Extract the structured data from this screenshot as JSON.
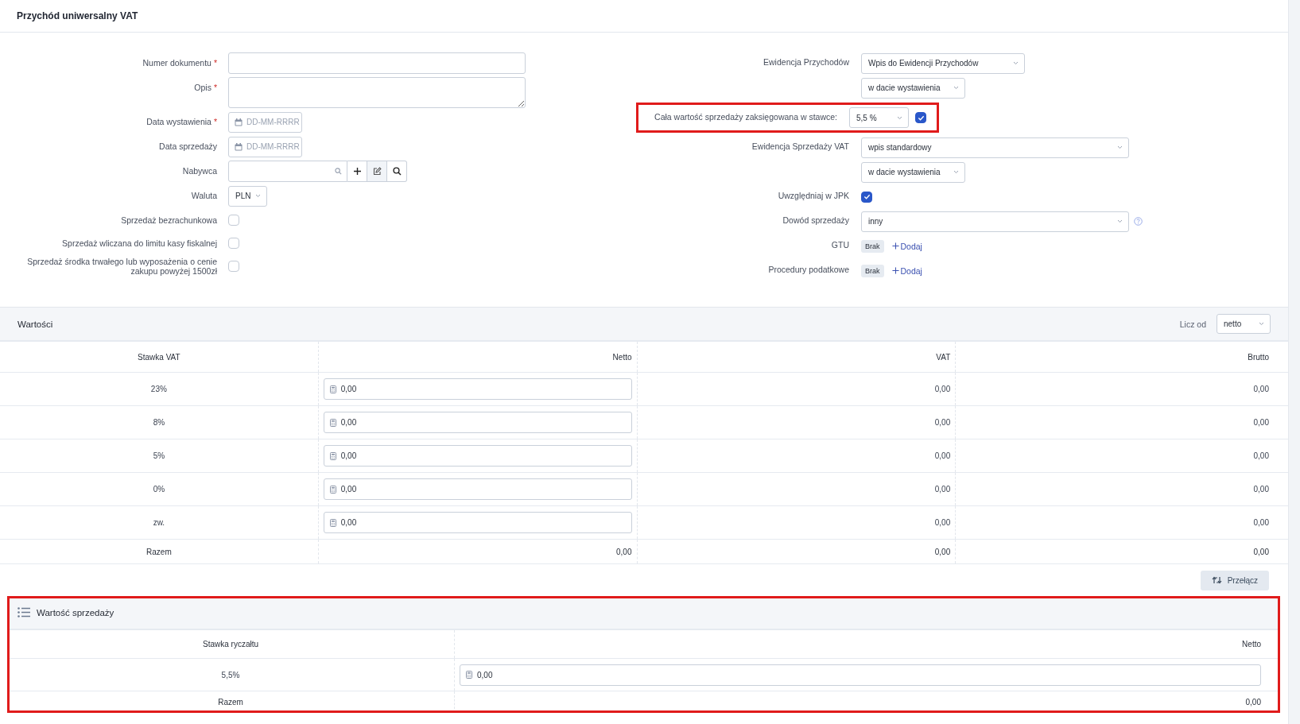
{
  "header": {
    "title": "Przychód uniwersalny VAT"
  },
  "form_left": [
    {
      "kind": "text",
      "label": "Numer dokumentu",
      "required_mark": "*"
    },
    {
      "kind": "textarea",
      "label": "Opis",
      "required_mark": "*"
    },
    {
      "kind": "date",
      "label": "Data wystawienia",
      "required_mark": "*",
      "placeholder": "DD-MM-RRRR"
    },
    {
      "kind": "date",
      "label": "Data sprzedaży",
      "placeholder": "DD-MM-RRRR"
    },
    {
      "kind": "lookup",
      "label": "Nabywca"
    },
    {
      "kind": "select",
      "label": "Waluta",
      "value": "PLN"
    },
    {
      "kind": "checkbox",
      "label": "Sprzedaż bezrachunkowa",
      "checked": false
    },
    {
      "kind": "checkbox",
      "label": "Sprzedaż wliczana do limitu kasy fiskalnej",
      "checked": false
    },
    {
      "kind": "checkbox",
      "label": "Sprzedaż środka trwałego lub wyposażenia o cenie zakupu powyżej 1500zł",
      "checked": false
    }
  ],
  "form_right": [
    {
      "kind": "select_medium",
      "label": "Ewidencja Przychodów",
      "value": "Wpis do Ewidencji Przychodów"
    },
    {
      "kind": "sub_select",
      "value": "w dacie wystawienia"
    },
    {
      "kind": "rate",
      "label": "Cała wartość sprzedaży zaksięgowana w stawce:",
      "value": "5,5 %",
      "checked": true,
      "highlighted": true
    },
    {
      "kind": "select",
      "label": "Ewidencja Sprzedaży VAT",
      "value": "wpis standardowy"
    },
    {
      "kind": "sub_select",
      "value": "w dacie wystawienia"
    },
    {
      "kind": "checkbox",
      "label": "Uwzględniaj w JPK",
      "checked": true
    },
    {
      "kind": "select",
      "label": "Dowód sprzedaży",
      "value": "inny",
      "help": true
    },
    {
      "kind": "tags",
      "label": "GTU",
      "badge": "Brak",
      "action": "Dodaj"
    },
    {
      "kind": "tags",
      "label": "Procedury podatkowe",
      "badge": "Brak",
      "action": "Dodaj"
    }
  ],
  "values": {
    "title": "Wartości",
    "calc_from": {
      "label": "Licz od",
      "value": "netto"
    },
    "columns": [
      "Stawka VAT",
      "Netto",
      "VAT",
      "Brutto"
    ],
    "rows": [
      {
        "rate": "23%",
        "netto": "0,00",
        "vat": "0,00",
        "brutto": "0,00"
      },
      {
        "rate": "8%",
        "netto": "0,00",
        "vat": "0,00",
        "brutto": "0,00"
      },
      {
        "rate": "5%",
        "netto": "0,00",
        "vat": "0,00",
        "brutto": "0,00"
      },
      {
        "rate": "0%",
        "netto": "0,00",
        "vat": "0,00",
        "brutto": "0,00"
      },
      {
        "rate": "zw.",
        "netto": "0,00",
        "vat": "0,00",
        "brutto": "0,00"
      }
    ],
    "total": {
      "label": "Razem",
      "netto": "0,00",
      "vat": "0,00",
      "brutto": "0,00"
    },
    "switch_button": "Przełącz"
  },
  "sales": {
    "title": "Wartość sprzedaży",
    "highlighted": true,
    "columns": [
      "Stawka ryczałtu",
      "Netto"
    ],
    "rows": [
      {
        "rate": "5,5%",
        "netto": "0,00"
      }
    ],
    "total": {
      "label": "Razem",
      "netto": "0,00"
    }
  }
}
